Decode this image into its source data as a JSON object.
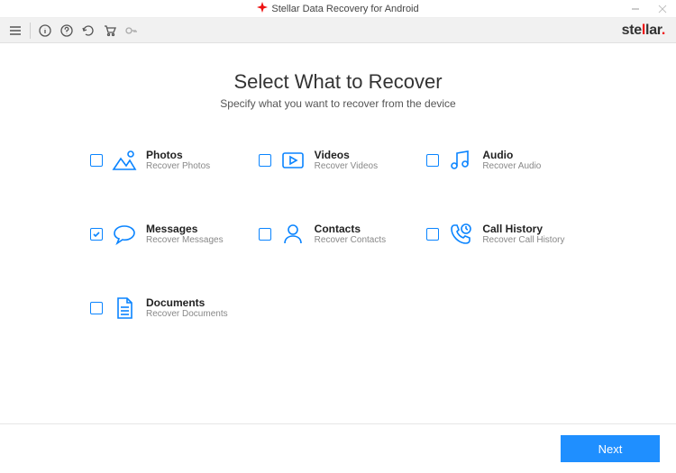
{
  "titlebar": {
    "title": "Stellar Data Recovery for Android"
  },
  "brand": {
    "prefix": "ste",
    "l": "l",
    "l2": "l",
    "suffix": "ar",
    "dot": "."
  },
  "heading": {
    "title": "Select What to Recover",
    "subtitle": "Specify what you want to recover from the device"
  },
  "options": [
    {
      "key": "photos",
      "title": "Photos",
      "subtitle": "Recover Photos",
      "checked": false,
      "icon": "photos-icon"
    },
    {
      "key": "videos",
      "title": "Videos",
      "subtitle": "Recover Videos",
      "checked": false,
      "icon": "videos-icon"
    },
    {
      "key": "audio",
      "title": "Audio",
      "subtitle": "Recover Audio",
      "checked": false,
      "icon": "audio-icon"
    },
    {
      "key": "messages",
      "title": "Messages",
      "subtitle": "Recover Messages",
      "checked": true,
      "icon": "messages-icon"
    },
    {
      "key": "contacts",
      "title": "Contacts",
      "subtitle": "Recover Contacts",
      "checked": false,
      "icon": "contacts-icon"
    },
    {
      "key": "callhistory",
      "title": "Call History",
      "subtitle": "Recover Call History",
      "checked": false,
      "icon": "callhistory-icon"
    },
    {
      "key": "documents",
      "title": "Documents",
      "subtitle": "Recover Documents",
      "checked": false,
      "icon": "documents-icon"
    }
  ],
  "footer": {
    "next": "Next"
  },
  "colors": {
    "accent": "#1f8fff",
    "icon": "#0a84ff"
  }
}
